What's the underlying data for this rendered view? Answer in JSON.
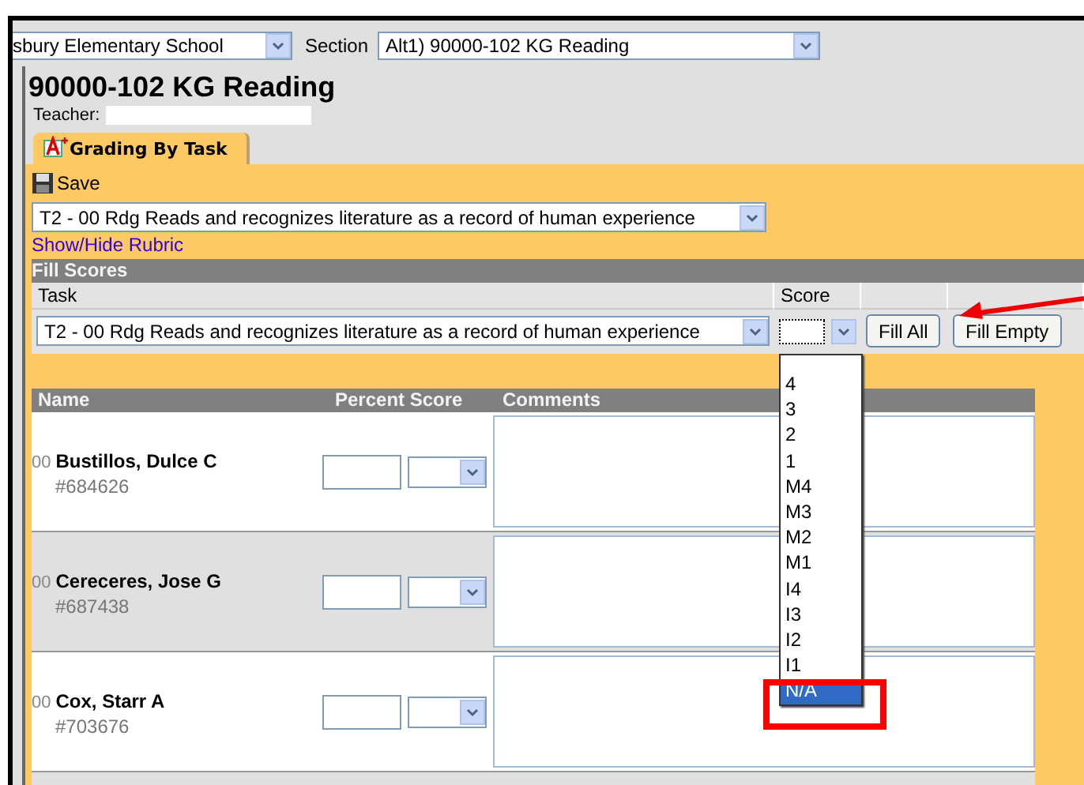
{
  "top_bar": {
    "school": "sbury Elementary School",
    "section_label": "Section",
    "section": "Alt1) 90000-102 KG Reading"
  },
  "title": "90000-102 KG Reading",
  "teacher_label": "Teacher:",
  "tabs": [
    {
      "label": "Grading By Task",
      "selected": true
    }
  ],
  "save": "Save",
  "task_select": "T2 - 00 Rdg Reads and recognizes literature as a record of human experience",
  "rubric_link": "Show/Hide Rubric",
  "fill_scores": {
    "title": "Fill Scores",
    "columns": [
      "Task",
      "Score"
    ],
    "task": "T2 - 00 Rdg Reads and recognizes literature as a record of human experience",
    "buttons": [
      "Fill All",
      "Fill Empty"
    ],
    "score_dropdown": {
      "expanded": true,
      "options": [
        {
          "label": "4",
          "selected": false
        },
        {
          "label": "3",
          "selected": false
        },
        {
          "label": "2",
          "selected": false
        },
        {
          "label": "1",
          "selected": false
        },
        {
          "label": "M4",
          "selected": false
        },
        {
          "label": "M3",
          "selected": false
        },
        {
          "label": "M2",
          "selected": false
        },
        {
          "label": "M1",
          "selected": false
        },
        {
          "label": "I4",
          "selected": false
        },
        {
          "label": "I3",
          "selected": false
        },
        {
          "label": "I2",
          "selected": false
        },
        {
          "label": "I1",
          "selected": false
        },
        {
          "label": "N/A",
          "selected": true
        }
      ]
    }
  },
  "table": {
    "columns": [
      "Name",
      "Percent Score",
      "Comments"
    ],
    "rows": [
      {
        "prefix": "00",
        "name": "Bustillos, Dulce C",
        "id": "#684626"
      },
      {
        "prefix": "00",
        "name": "Cereceres, Jose G",
        "id": "#687438"
      },
      {
        "prefix": "00",
        "name": "Cox, Starr A",
        "id": "#703676"
      }
    ]
  }
}
